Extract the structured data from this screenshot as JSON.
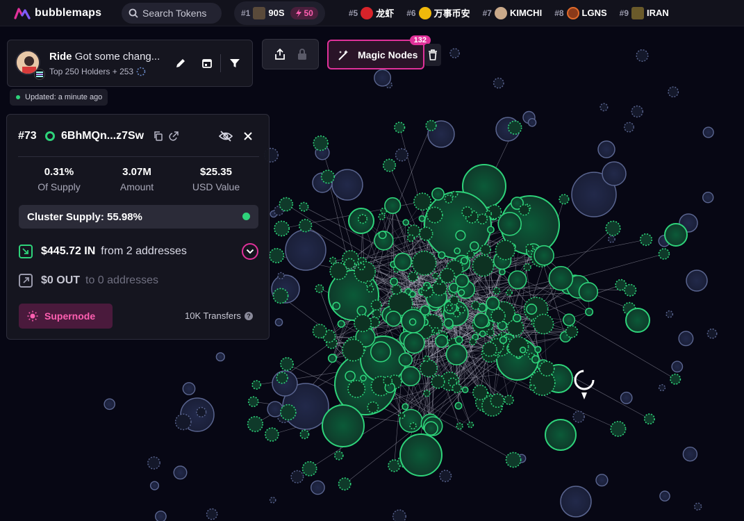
{
  "brand": {
    "name": "bubblemaps"
  },
  "search": {
    "placeholder": "Search Tokens"
  },
  "trending": [
    {
      "rank": "#1",
      "name": "90S",
      "boost": "50"
    },
    {
      "rank": "#5",
      "name": "龙虾"
    },
    {
      "rank": "#6",
      "name": "万事币安"
    },
    {
      "rank": "#7",
      "name": "KIMCHI"
    },
    {
      "rank": "#8",
      "name": "LGNS"
    },
    {
      "rank": "#9",
      "name": "IRAN"
    }
  ],
  "header": {
    "name": "Ride",
    "description": "Got some chang...",
    "subtitle": "Top 250 Holders + 253",
    "updated": "Updated: a minute ago"
  },
  "toolbar": {
    "magic_label": "Magic Nodes",
    "magic_count": "132"
  },
  "node": {
    "rank": "#73",
    "address": "6BhMQn...z7Sw",
    "stats": [
      {
        "value": "0.31%",
        "label": "Of Supply"
      },
      {
        "value": "3.07M",
        "label": "Amount"
      },
      {
        "value": "$25.35",
        "label": "USD Value"
      }
    ],
    "cluster_supply": "Cluster Supply: 55.98%",
    "in_amount": "$445.72 IN",
    "in_from": "from 2 addresses",
    "out_amount": "$0 OUT",
    "out_to": "to 0 addresses",
    "supernode_label": "Supernode",
    "transfers": "10K Transfers"
  },
  "colors": {
    "accent": "#e0319a",
    "green": "#2ed37a",
    "node_fill": "#0d4a30",
    "gray_node": "#2a3150"
  }
}
